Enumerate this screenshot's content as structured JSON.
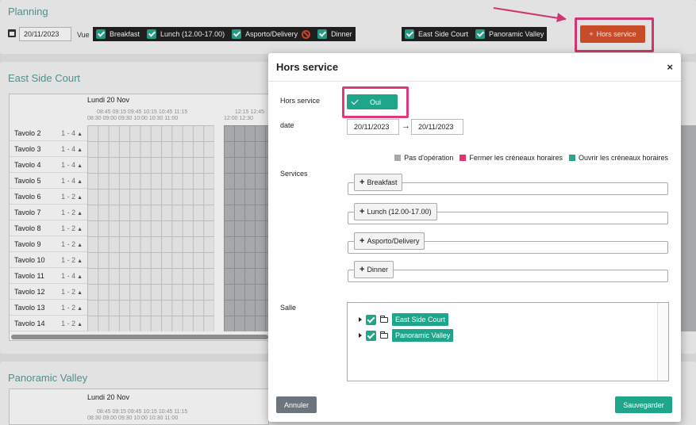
{
  "page": {
    "title": "Planning",
    "date": "20/11/2023",
    "vue_label": "Vue",
    "services": [
      {
        "label": "Breakfast"
      },
      {
        "label": "Lunch (12.00-17.00)"
      },
      {
        "label": "Asporto/Delivery"
      },
      {
        "label": "Dinner"
      }
    ],
    "rooms": [
      {
        "label": "East Side Court"
      },
      {
        "label": "Panoramic Valley"
      }
    ],
    "hors_service_button": "Hors service",
    "hors_service_plus": "+",
    "east_section_title": "East Side Court",
    "pano_section_title": "Panoramic Valley",
    "day_label": "Lundi 20 Nov",
    "times_top": "08:45  09:15  09:45  10:15  10:45  11:15",
    "times_bottom": "08:30  09:00  09:30  10:00  10:30  11:00",
    "times_right_top": "12:15  12:45",
    "times_right_bottom": "12:00  12:30",
    "tables": [
      {
        "name": "Tavolo 2",
        "cap": "1 - 4"
      },
      {
        "name": "Tavolo 3",
        "cap": "1 - 4"
      },
      {
        "name": "Tavolo 4",
        "cap": "1 - 4"
      },
      {
        "name": "Tavolo 5",
        "cap": "1 - 4"
      },
      {
        "name": "Tavolo 6",
        "cap": "1 - 2"
      },
      {
        "name": "Tavolo 7",
        "cap": "1 - 2"
      },
      {
        "name": "Tavolo 8",
        "cap": "1 - 2"
      },
      {
        "name": "Tavolo 9",
        "cap": "1 - 2"
      },
      {
        "name": "Tavolo 10",
        "cap": "1 - 2"
      },
      {
        "name": "Tavolo 11",
        "cap": "1 - 4"
      },
      {
        "name": "Tavolo 12",
        "cap": "1 - 2"
      },
      {
        "name": "Tavolo 13",
        "cap": "1 - 2"
      },
      {
        "name": "Tavolo 14",
        "cap": "1 - 2"
      }
    ]
  },
  "modal": {
    "title": "Hors service",
    "close": "×",
    "hors_service_label": "Hors service",
    "hors_service_toggle": "Oui",
    "date_label": "date",
    "date_from": "20/11/2023",
    "date_arrow": "→",
    "date_to": "20/11/2023",
    "legend": [
      {
        "label": "Pas d'opération",
        "color": "#a9a9a9"
      },
      {
        "label": "Fermer les créneaux horaires",
        "color": "#e0336f"
      },
      {
        "label": "Ouvrir les créneaux horaires",
        "color": "#2aa58f"
      }
    ],
    "services_label": "Services",
    "services": [
      {
        "label": "Breakfast"
      },
      {
        "label": "Lunch (12.00-17.00)"
      },
      {
        "label": "Asporto/Delivery"
      },
      {
        "label": "Dinner"
      }
    ],
    "salle_label": "Salle",
    "salles": [
      {
        "label": "East Side Court"
      },
      {
        "label": "Panoramic Valley"
      }
    ],
    "cancel_label": "Annuler",
    "save_label": "Sauvegarder"
  },
  "colors": {
    "accent": "#1fa58a",
    "hors_service": "#d9532c",
    "highlight": "#e03a7c"
  }
}
